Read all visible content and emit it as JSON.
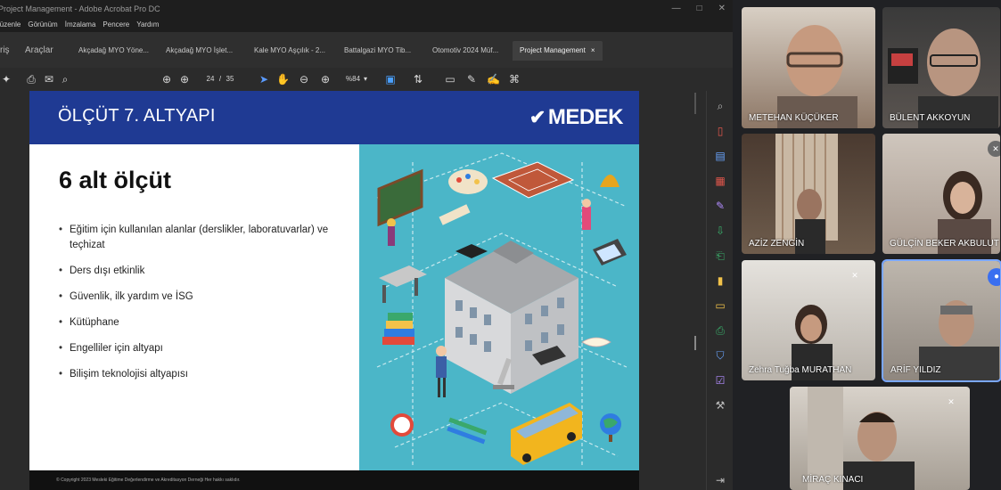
{
  "acrobat": {
    "window_title": "Project Management - Adobe Acrobat Pro DC",
    "window_controls": [
      "—",
      "□",
      "✕"
    ],
    "menu": [
      "Düzenle",
      "Görünüm",
      "İmzalama",
      "Pencere",
      "Yardım"
    ],
    "left_tabs": [
      "Giriş",
      "Araçlar"
    ],
    "tabs": [
      "Akçadağ MYO Yöne...",
      "Akçadağ MYO İşlet...",
      "Kale MYO Aşçılık - 2...",
      "Battalgazi MYO Tib...",
      "Otomotiv 2024 Müf...",
      "Project Management"
    ],
    "active_tab_close": "×",
    "toolbar": {
      "page_current": "24",
      "page_sep": "/",
      "page_total": "35",
      "zoom": "%84",
      "zoom_caret": "▾"
    }
  },
  "slide": {
    "header_title": "ÖLÇÜT 7. ALTYAPI",
    "logo_text": "MEDEK",
    "logo_mark": "✔",
    "title": "6 alt ölçüt",
    "bullets": [
      "Eğitim için kullanılan alanlar (derslikler, laboratuvarlar) ve teçhizat",
      "Ders dışı etkinlik",
      "Güvenlik, ilk yardım ve İSG",
      "Kütüphane",
      "Engelliler için altyapı",
      "Bilişim teknolojisi altyapısı"
    ],
    "footer": "© Copyright 2023 Mesleki Eğitime Değerlendirme ve Akreditasyon Derneği Her hakkı saklıdır."
  },
  "participants": [
    {
      "name": "METEHAN KÜÇÜKER",
      "muted": false
    },
    {
      "name": "BÜLENT AKKOYUN",
      "muted": false
    },
    {
      "name": "AZİZ ZENGİN",
      "muted": false
    },
    {
      "name": "GÜLÇİN BEKER AKBULUT",
      "muted": true
    },
    {
      "name": "Zehra Tuğba MURATHAN",
      "muted": true
    },
    {
      "name": "ARİF YILDIZ",
      "muted": false,
      "speaking": true
    },
    {
      "name": "MİRAÇ KINACI",
      "muted": true
    }
  ],
  "colors": {
    "slide_header": "#1f3a93",
    "slide_art_bg": "#4bb6c8",
    "speaker_outline": "#7aa7ff"
  }
}
